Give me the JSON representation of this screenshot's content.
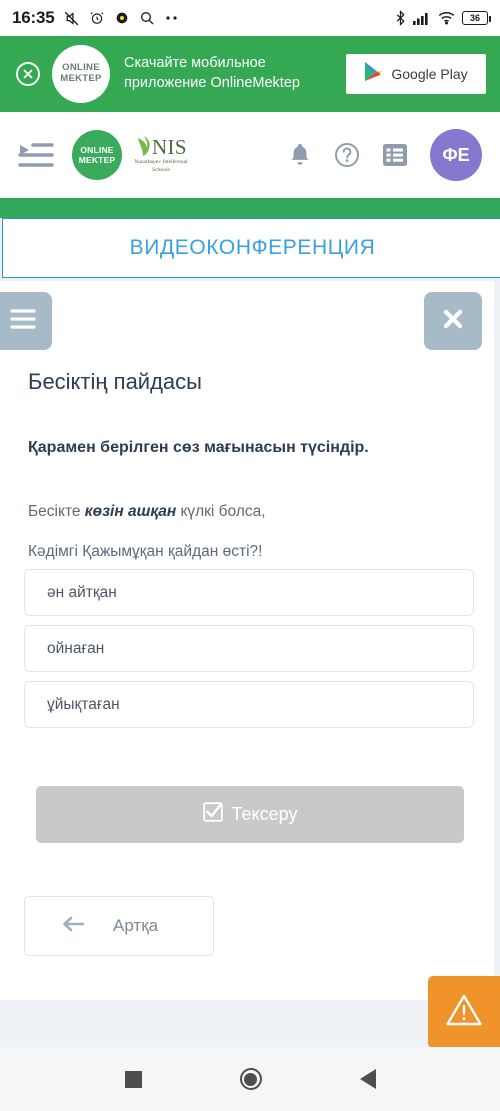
{
  "statusbar": {
    "time": "16:35",
    "icons": [
      "mute-icon",
      "alarm-icon",
      "app-dot-icon",
      "search-icon",
      "more-dots-icon"
    ],
    "right_icons": [
      "bluetooth-icon",
      "cellular-signal-icon",
      "wifi-icon"
    ],
    "battery_level": "36"
  },
  "promo": {
    "close_label": "close-icon",
    "logo_line1": "ONLINE",
    "logo_line2": "MEKTEP",
    "text_line1": "Скачайте мобильное",
    "text_line2": "приложение OnlineMektep",
    "store_button_label": "Google Play",
    "background_color": "#34a853"
  },
  "navbar": {
    "toggle_icon": "menu-indent-icon",
    "brand_om_line1": "ONLINE",
    "brand_om_line2": "MEKTEP",
    "brand_nis": "NIS",
    "brand_nis_sub": "Nazarbayev Intellectual Schools",
    "icons": [
      "bell-icon",
      "help-circle-icon",
      "list-icon"
    ],
    "avatar_initials": "ФЕ",
    "avatar_color": "#8478cf"
  },
  "videoconference": {
    "title": "ВИДЕОКОНФЕРЕНЦИЯ",
    "accent_color": "#3aa0e0"
  },
  "lesson": {
    "menu_button_icon": "hamburger-icon",
    "close_button_icon": "close-icon",
    "title": "Бесіктің пайдасы",
    "prompt": "Қарамен берілген сөз мағынасын түсіндір.",
    "sentence_prefix": "Бесікте ",
    "sentence_highlight": "көзін ашқан",
    "sentence_suffix": " күлкі болса,",
    "sentence_line2": "Кәдімгі Қажымұқан қайдан өсті?!",
    "options": [
      "ән айтқан",
      "ойнаған",
      "ұйықтаған"
    ],
    "check_button_label": "Тексеру",
    "check_button_icon": "checkbox-icon",
    "back_button_label": "Артқа",
    "back_button_icon": "arrow-left-icon",
    "report_button_icon": "warning-triangle-icon",
    "report_button_color": "#f0932b"
  },
  "androidnav": {
    "recents": "recents-square-icon",
    "home": "home-circle-icon",
    "back": "back-triangle-icon"
  }
}
